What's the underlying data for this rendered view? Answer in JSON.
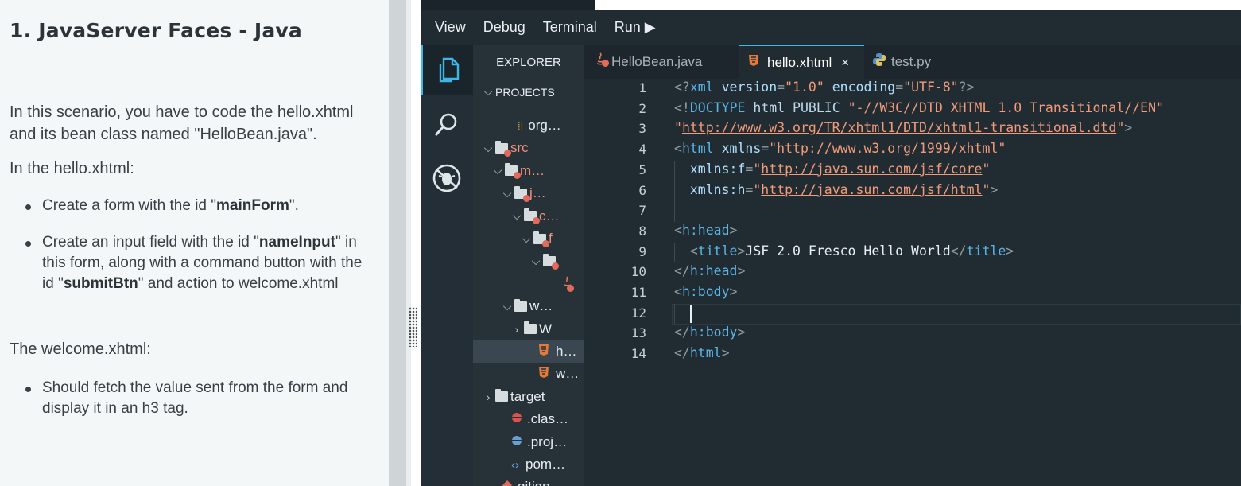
{
  "instructions": {
    "title": "1. JavaServer Faces - Java",
    "intro": "In this scenario, you have to code the hello.xhtml and its bean class named \"HelloBean.java\".",
    "hello_heading": "In the hello.xhtml:",
    "hello_items": [
      {
        "pre": "Create a form with the id \"",
        "bold": "mainForm",
        "post": "\"."
      },
      {
        "pre": "Create an input field with the id \"",
        "bold": "nameInput",
        "mid": "\" in this form, along with a command button with the id \"",
        "bold2": "submitBtn",
        "post": "\" and action to welcome.xhtml"
      }
    ],
    "welcome_heading": "The welcome.xhtml:",
    "welcome_items": [
      "Should fetch the value sent from the form and display it in an h3 tag."
    ]
  },
  "ide": {
    "menu": [
      "View",
      "Debug",
      "Terminal",
      "Run ▶"
    ],
    "activity_icons": [
      "files-icon",
      "search-icon",
      "debug-icon"
    ],
    "explorer": {
      "title": "EXPLORER",
      "section": "PROJECTS",
      "rows": [
        {
          "label": "org…",
          "kind": "file-hash",
          "indent": 56,
          "error": false
        },
        {
          "label": "src",
          "kind": "folder",
          "indent": 30,
          "chev": "down",
          "error": true
        },
        {
          "label": "m…",
          "kind": "folder",
          "indent": 42,
          "chev": "down",
          "error": true
        },
        {
          "label": "j…",
          "kind": "folder",
          "indent": 54,
          "chev": "down",
          "error": true
        },
        {
          "label": "c…",
          "kind": "folder",
          "indent": 66,
          "chev": "down",
          "error": true
        },
        {
          "label": "f",
          "kind": "folder",
          "indent": 78,
          "chev": "down",
          "error": true
        },
        {
          "label": "",
          "kind": "folder",
          "indent": 90,
          "chev": "down",
          "error": true
        },
        {
          "label": "",
          "kind": "java",
          "indent": 112,
          "error": true
        },
        {
          "label": "w…",
          "kind": "folder",
          "indent": 54,
          "chev": "down",
          "error": false
        },
        {
          "label": "W",
          "kind": "folder",
          "indent": 66,
          "chev": "right",
          "error": false
        },
        {
          "label": "h…",
          "kind": "html",
          "indent": 82,
          "error": false,
          "selected": true
        },
        {
          "label": "w…",
          "kind": "html",
          "indent": 82,
          "error": false
        },
        {
          "label": "target",
          "kind": "folder",
          "indent": 30,
          "chev": "right",
          "error": false
        },
        {
          "label": ".clas…",
          "kind": "dot-red",
          "indent": 48,
          "error": false
        },
        {
          "label": ".proj…",
          "kind": "dot-blue",
          "indent": 48,
          "error": false
        },
        {
          "label": "pom…",
          "kind": "xml",
          "indent": 48,
          "error": false
        },
        {
          "label": "gitign",
          "kind": "git",
          "indent": 36,
          "error": false
        }
      ]
    },
    "tabs": [
      {
        "label": "HelloBean.java",
        "icon": "java-icon",
        "active": false
      },
      {
        "label": "hello.xhtml",
        "icon": "html-icon",
        "active": true,
        "close": "×"
      },
      {
        "label": "test.py",
        "icon": "python-icon",
        "active": false
      }
    ],
    "editor": {
      "line_numbers": [
        "1",
        "2",
        "3",
        "4",
        "5",
        "6",
        "7",
        "8",
        "9",
        "10",
        "11",
        "12",
        "13",
        "14"
      ],
      "lines": [
        [
          [
            "punc",
            "<?"
          ],
          [
            "tag",
            "xml"
          ],
          [
            "text",
            " "
          ],
          [
            "attr",
            "version"
          ],
          [
            "punc",
            "="
          ],
          [
            "str",
            "\"1.0\""
          ],
          [
            "text",
            " "
          ],
          [
            "attr",
            "encoding"
          ],
          [
            "punc",
            "="
          ],
          [
            "str",
            "\"UTF-8\""
          ],
          [
            "punc",
            "?>"
          ]
        ],
        [
          [
            "punc",
            "<!"
          ],
          [
            "tag",
            "DOCTYPE"
          ],
          [
            "text",
            " "
          ],
          [
            "kw",
            "html PUBLIC"
          ],
          [
            "text",
            " "
          ],
          [
            "str",
            "\"-//W3C//DTD XHTML 1.0 Transitional//EN\""
          ]
        ],
        [
          [
            "str",
            "\""
          ],
          [
            "url",
            "http://www.w3.org/TR/xhtml1/DTD/xhtml1-transitional.dtd"
          ],
          [
            "str",
            "\""
          ],
          [
            "punc",
            ">"
          ]
        ],
        [
          [
            "punc",
            "<"
          ],
          [
            "tag",
            "html"
          ],
          [
            "text",
            " "
          ],
          [
            "attr",
            "xmlns"
          ],
          [
            "punc",
            "="
          ],
          [
            "str",
            "\""
          ],
          [
            "url",
            "http://www.w3.org/1999/xhtml"
          ],
          [
            "str",
            "\""
          ]
        ],
        [
          [
            "text",
            "  "
          ],
          [
            "attr",
            "xmlns:f"
          ],
          [
            "punc",
            "="
          ],
          [
            "str",
            "\""
          ],
          [
            "url",
            "http://java.sun.com/jsf/core"
          ],
          [
            "str",
            "\""
          ]
        ],
        [
          [
            "text",
            "  "
          ],
          [
            "attr",
            "xmlns:h"
          ],
          [
            "punc",
            "="
          ],
          [
            "str",
            "\""
          ],
          [
            "url",
            "http://java.sun.com/jsf/html"
          ],
          [
            "str",
            "\""
          ],
          [
            "punc",
            ">"
          ]
        ],
        [],
        [
          [
            "punc",
            "<"
          ],
          [
            "tag",
            "h:head"
          ],
          [
            "punc",
            ">"
          ]
        ],
        [
          [
            "text",
            "  "
          ],
          [
            "punc",
            "<"
          ],
          [
            "tag",
            "title"
          ],
          [
            "punc",
            ">"
          ],
          [
            "text",
            "JSF 2.0 Fresco Hello World"
          ],
          [
            "punc",
            "</"
          ],
          [
            "tag",
            "title"
          ],
          [
            "punc",
            ">"
          ]
        ],
        [
          [
            "punc",
            "</"
          ],
          [
            "tag",
            "h:head"
          ],
          [
            "punc",
            ">"
          ]
        ],
        [
          [
            "punc",
            "<"
          ],
          [
            "tag",
            "h:body"
          ],
          [
            "punc",
            ">"
          ]
        ],
        [],
        [
          [
            "punc",
            "</"
          ],
          [
            "tag",
            "h:body"
          ],
          [
            "punc",
            ">"
          ]
        ],
        [
          [
            "punc",
            "</"
          ],
          [
            "tag",
            "html"
          ],
          [
            "punc",
            ">"
          ]
        ]
      ],
      "current_line": 12
    },
    "colors": {
      "accent": "#3fb6e8",
      "error": "#e06a5e"
    }
  }
}
